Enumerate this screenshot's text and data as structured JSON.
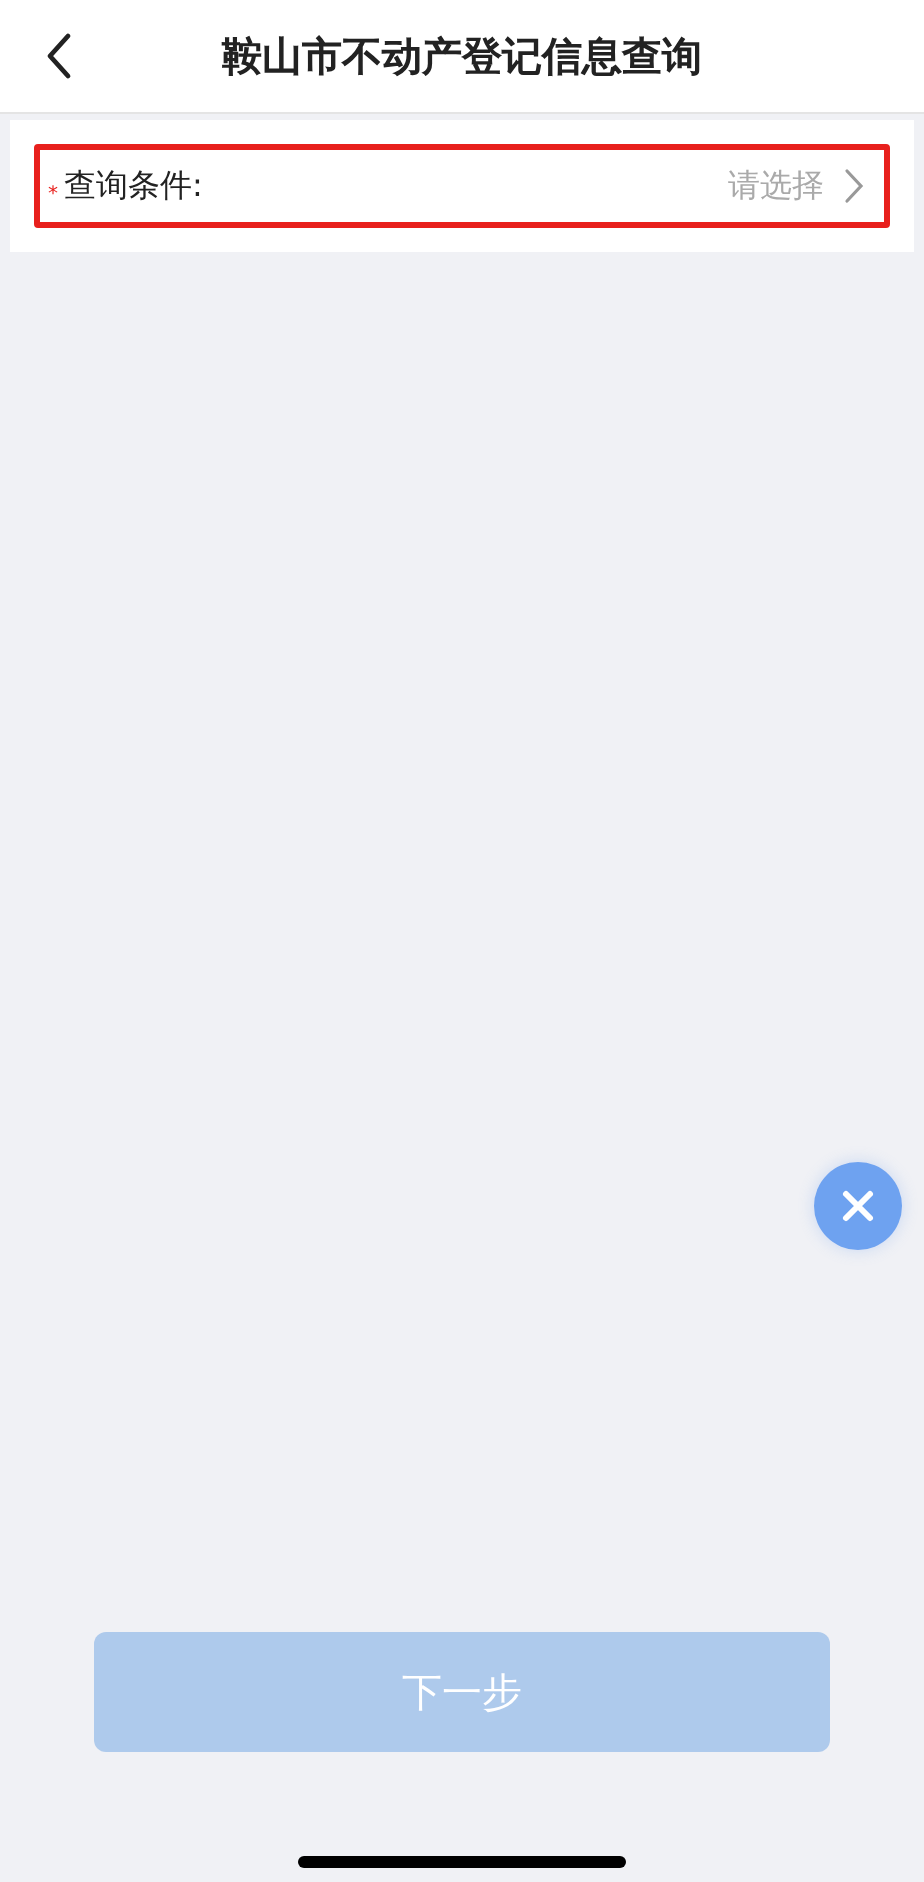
{
  "header": {
    "title": "鞍山市不动产登记信息查询"
  },
  "form": {
    "field": {
      "required_mark": "*",
      "label": "查询条件:",
      "placeholder": "请选择",
      "highlighted": true
    }
  },
  "next_button": {
    "label": "下一步",
    "disabled": true
  }
}
